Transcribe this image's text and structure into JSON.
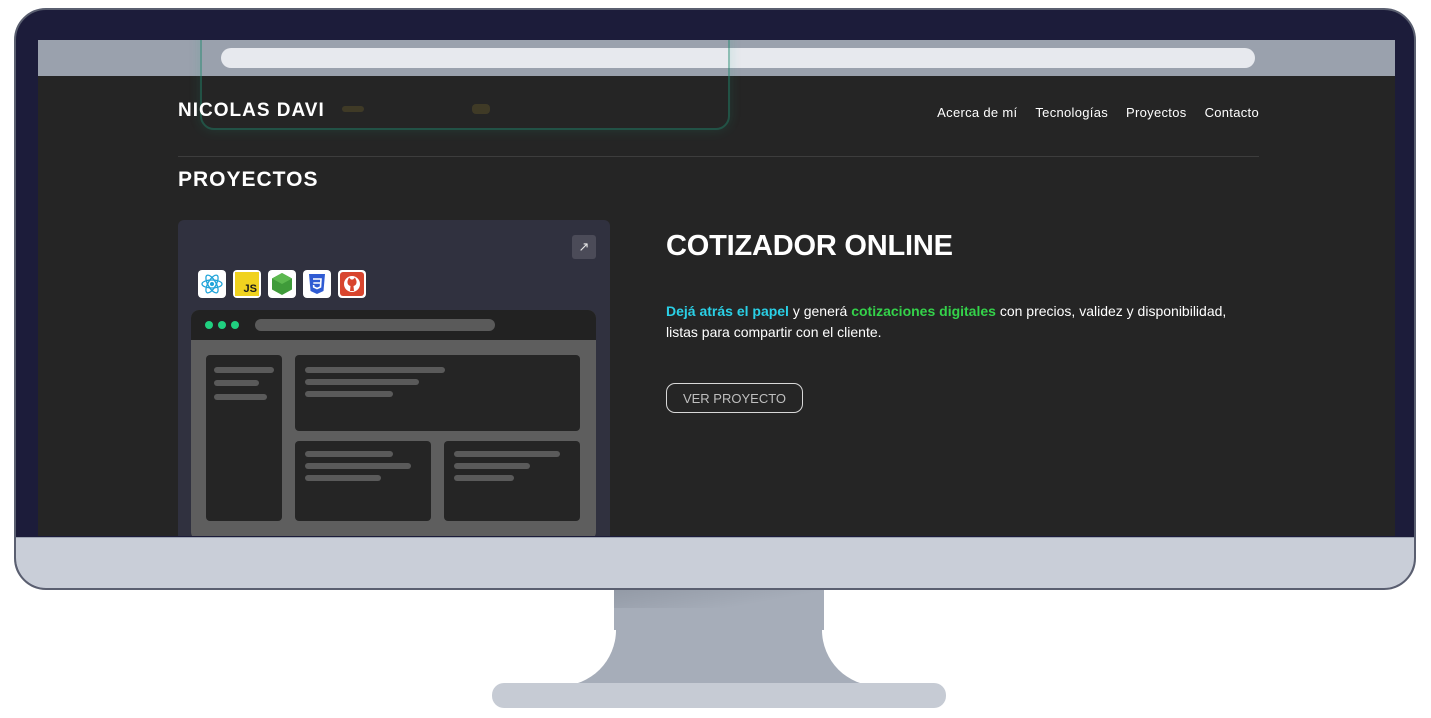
{
  "header": {
    "logo": "NICOLAS DAVI",
    "nav": [
      "Acerca de mí",
      "Tecnologías",
      "Proyectos",
      "Contacto"
    ]
  },
  "section": {
    "title": "PROYECTOS"
  },
  "project": {
    "title": "COTIZADOR ONLINE",
    "description": {
      "highlight1": "Dejá atrás el papel",
      "text1": " y generá ",
      "highlight2": "cotizaciones digitales",
      "text2": " con precios, validez y disponibilidad, listas para compartir con el cliente."
    },
    "button_label": "VER PROYECTO",
    "external_link_icon": "↗",
    "tech_icons": [
      "react-icon",
      "javascript-icon",
      "nodejs-icon",
      "css3-icon",
      "github-icon"
    ],
    "js_label": "JS"
  },
  "colors": {
    "background": "#252525",
    "accent_cyan": "#2ad0e6",
    "accent_green": "#34d24a",
    "monitor_frame": "#1c1c3a"
  }
}
